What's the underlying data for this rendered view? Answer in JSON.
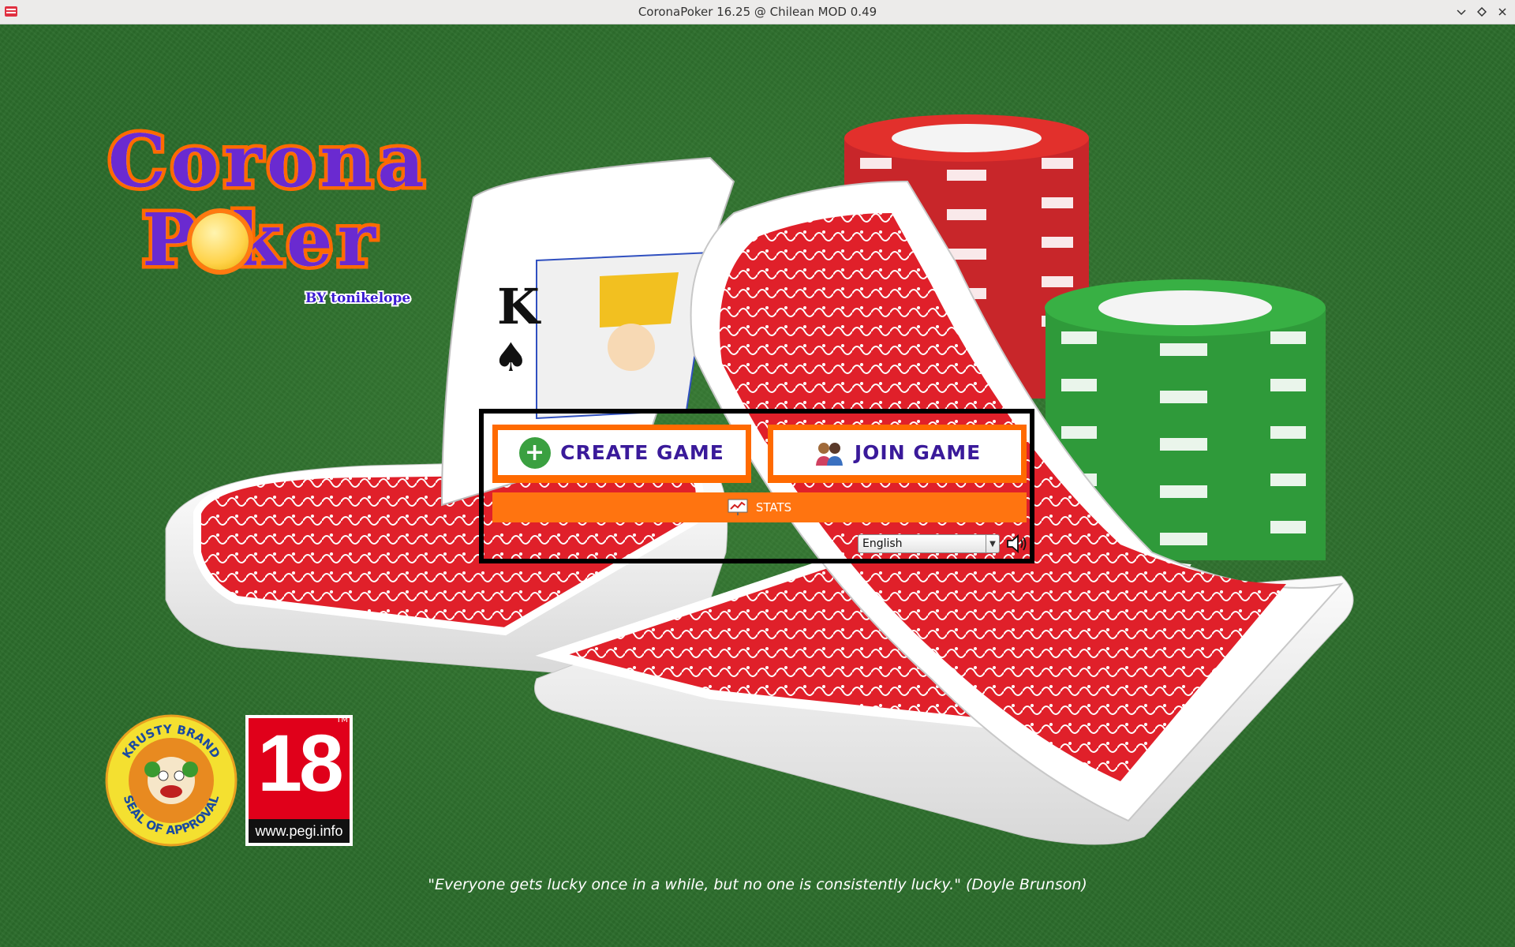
{
  "window": {
    "title": "CoronaPoker 16.25 @ Chilean MOD 0.49",
    "controls": [
      "minimize-icon",
      "maximize-icon",
      "close-icon"
    ]
  },
  "logo": {
    "line1": "Corona",
    "line2": "P  ker",
    "byline": "BY tonikelope"
  },
  "menu": {
    "create_label": "CREATE GAME",
    "join_label": "JOIN GAME",
    "stats_label": "STATS",
    "language_value": "English"
  },
  "badges": {
    "krusty_text_top": "KRUSTY BRAND",
    "krusty_text_bottom": "SEAL OF APPROVAL",
    "pegi_rating": "18",
    "pegi_url": "www.pegi.info",
    "pegi_tm": "TM"
  },
  "quote": "\"Everyone gets lucky once in a while, but no one is consistently lucky.\" (Doyle Brunson)",
  "colors": {
    "felt": "#2b6c2b",
    "accent_orange": "#ff6a00",
    "button_text": "#3a1a9a",
    "chip_red": "#d8322a",
    "chip_green": "#3aa040"
  }
}
